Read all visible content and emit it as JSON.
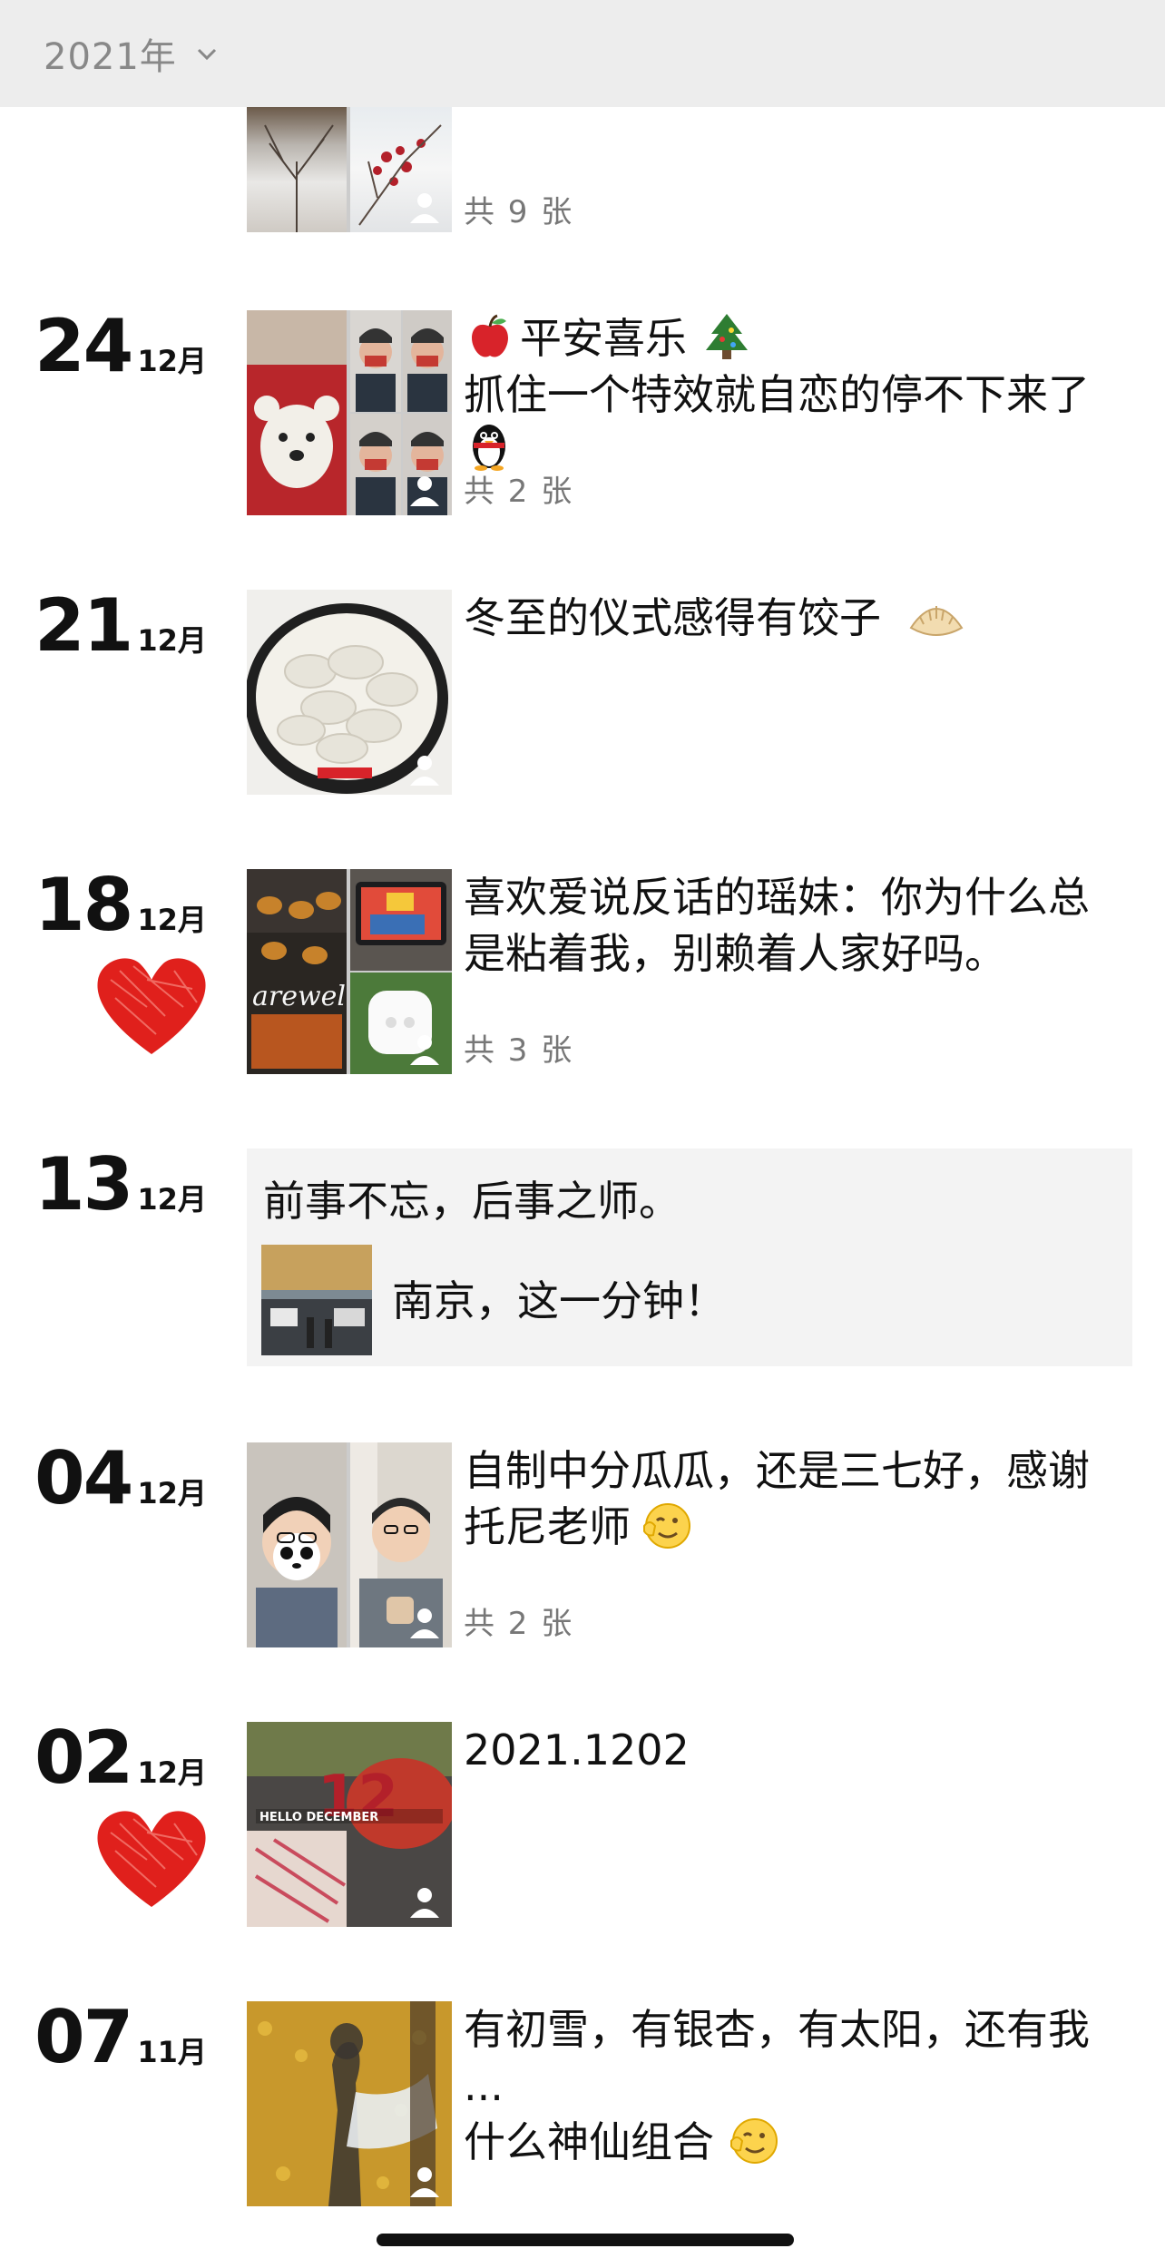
{
  "header": {
    "year": "2021年"
  },
  "entries": [
    {
      "count": "共 9 张"
    },
    {
      "day": "24",
      "month": "12月",
      "text": "平安喜乐\n抓住一个特效就自恋的停不下来了",
      "count": "共 2 张"
    },
    {
      "day": "21",
      "month": "12月",
      "text": "冬至的仪式感得有饺子"
    },
    {
      "day": "18",
      "month": "12月",
      "text": "喜欢爱说反话的瑶妹：你为什么总\n是粘着我，别赖着人家好吗。",
      "count": "共 3 张"
    },
    {
      "day": "13",
      "month": "12月",
      "text": "前事不忘，后事之师。",
      "share_title": "南京，这一分钟！"
    },
    {
      "day": "04",
      "month": "12月",
      "text": "自制中分瓜瓜，还是三七好，感谢\n托尼老师",
      "count": "共 2 张"
    },
    {
      "day": "02",
      "month": "12月",
      "text": "2021.1202"
    },
    {
      "day": "07",
      "month": "11月",
      "text": "有初雪，有银杏，有太阳，还有我\n...\n什么神仙组合"
    }
  ],
  "colors": {
    "header_bg": "#ededed",
    "heart": "#e0201c",
    "card_bg": "#f3f3f3"
  }
}
